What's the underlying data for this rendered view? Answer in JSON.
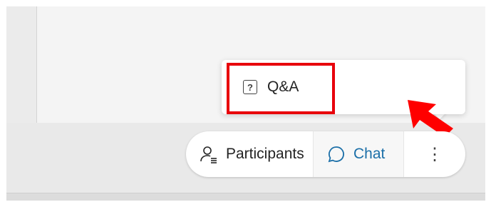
{
  "controls": {
    "participants_label": "Participants",
    "chat_label": "Chat",
    "more_label": "⋮"
  },
  "menu": {
    "items": [
      {
        "label": "Q&A",
        "icon": "qa-icon"
      }
    ]
  },
  "annotation": {
    "highlight_color": "#e8000b",
    "arrow_color": "#ff0000"
  },
  "icons": {
    "qa_glyph": "?"
  }
}
